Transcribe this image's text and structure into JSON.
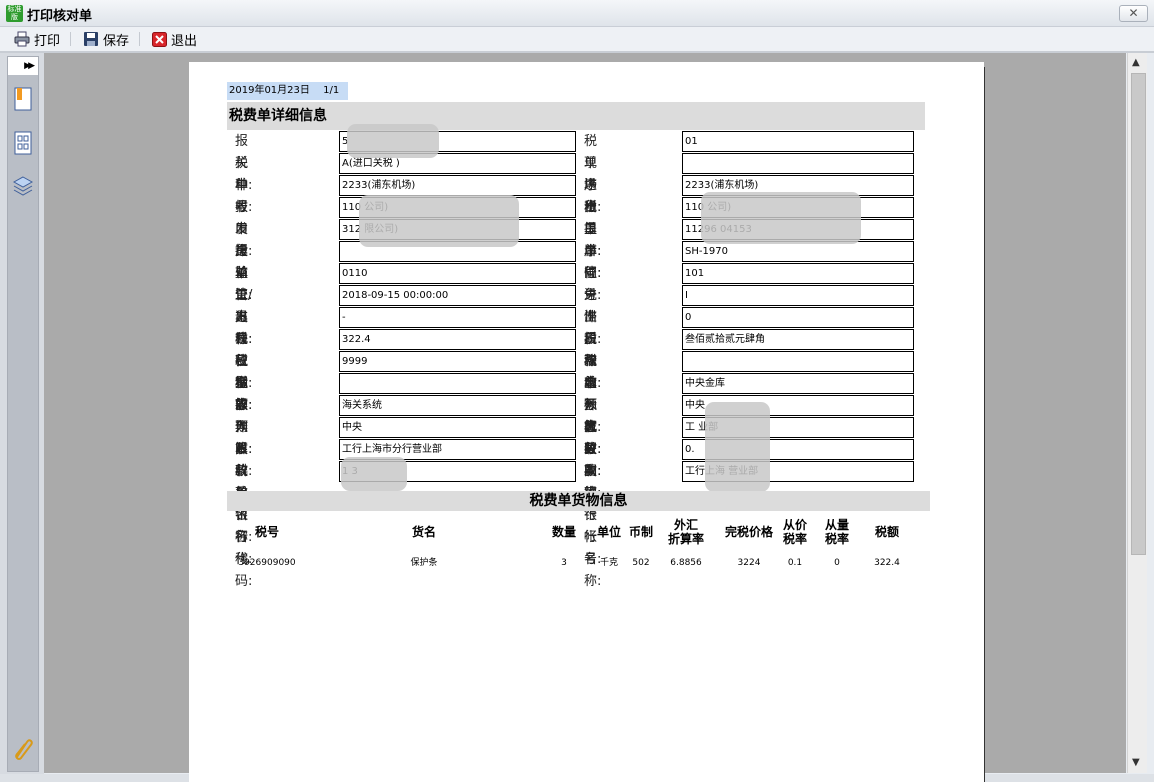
{
  "window": {
    "title": "打印核对单",
    "app_icon_text": "标准版",
    "close_symbol": "✕"
  },
  "toolbar": {
    "print_label": "打印",
    "save_label": "保存",
    "exit_label": "退出"
  },
  "sidebar": {
    "expand_symbol": "▶▶"
  },
  "scrollbar": {
    "up": "▲",
    "down": "▼"
  },
  "page": {
    "date": "2019年01月23日",
    "page_no": "1/1",
    "detail_title": "税费单详细信息",
    "goods_title": "税费单货物信息"
  },
  "rows": [
    {
      "l1": "报关单号:",
      "v1": "                    5",
      "l2": "税单序号:",
      "v2": "01"
    },
    {
      "l1": "税种:",
      "v1": "A(进口关税 )",
      "l2": "现场税单序:",
      "v2": ""
    },
    {
      "l1": "申报口岸:",
      "v1": "2233(浦东机场)",
      "l2": "进出口岸:",
      "v2": "2233(浦东机场)"
    },
    {
      "l1": "收发货单位:",
      "v1": "110                                              公司)",
      "l2": "货主单位:",
      "v2": "110                                              公司)"
    },
    {
      "l1": "申报单位:",
      "v1": "312                                          限公司)",
      "l2": "提单号:",
      "v2": "11296                               04153"
    },
    {
      "l1": "运输工具号:",
      "v1": "",
      "l2": "合同号:",
      "v2": "SH-1970"
    },
    {
      "l1": "监管方式:",
      "v1": "0110",
      "l2": "征免性质:",
      "v2": "101"
    },
    {
      "l1": "进/出口日期:",
      "v1": "2018-09-15 00:00:00",
      "l2": "进出口标志:",
      "v2": "I"
    },
    {
      "l1": "退补税标志:",
      "v1": "-",
      "l2": "滞报滞纳标志:",
      "v2": "0"
    },
    {
      "l1": "税款金额:",
      "v1": "322.4",
      "l2": "税款金额大写:",
      "v2": "叁佰贰拾贰元肆角"
    },
    {
      "l1": "征税操作员:",
      "v1": "9999",
      "l2": "税单开征日期:",
      "v2": ""
    },
    {
      "l1": "缴款期限:",
      "v1": "",
      "l2": "收入机关:",
      "v2": "中央金库"
    },
    {
      "l1": "收入系统:",
      "v1": "海关系统",
      "l2": "预算级次:",
      "v2": "中央"
    },
    {
      "l1": "预算科目名称:",
      "v1": "中央",
      "l2": "收款国库:",
      "v2": "工                    业部"
    },
    {
      "l1": "收款单位名称:",
      "v1": "工行上海市分行营业部",
      "l2": "收款银行帐号:",
      "v2": "0."
    },
    {
      "l1": "收款银行代码:",
      "v1": "1                3",
      "l2": "收款银行名称:",
      "v2": "工行上海              营业部"
    }
  ],
  "goods": {
    "headers": [
      "税号",
      "货名",
      "数量",
      "单位",
      "币制",
      "外汇\n折算率",
      "完税价格",
      "从价\n税率",
      "从量\n税率",
      "税额"
    ],
    "items": [
      [
        "3926909090",
        "保护条",
        "3",
        "千克",
        "502",
        "6.8856",
        "3224",
        "0.1",
        "0",
        "322.4"
      ]
    ]
  }
}
